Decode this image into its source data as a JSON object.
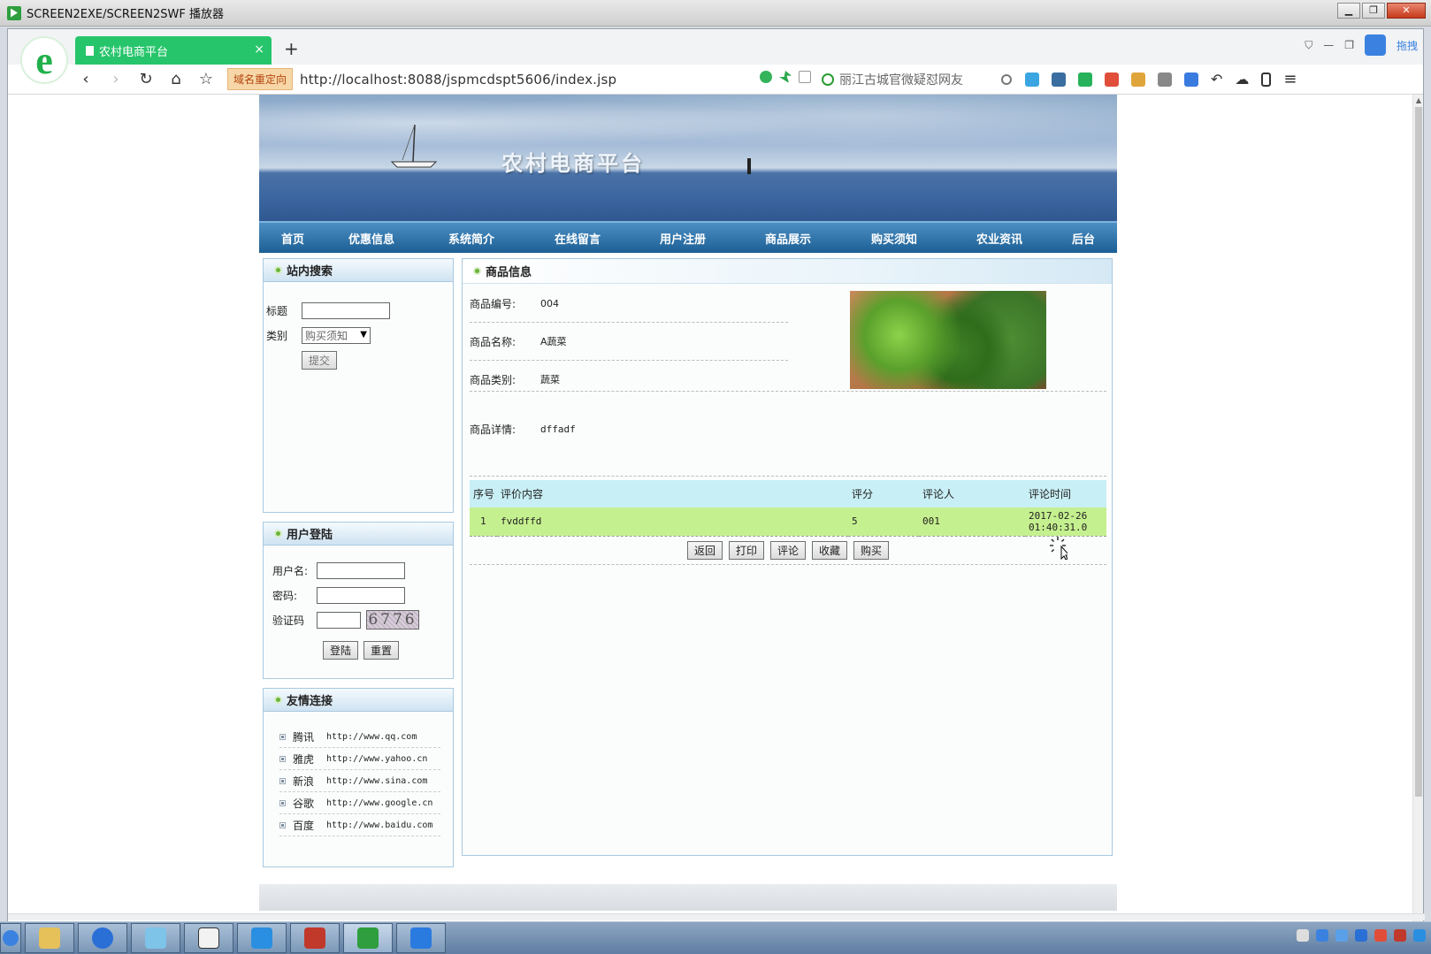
{
  "window": {
    "title": "SCREEN2EXE/SCREEN2SWF 播放器",
    "controls": [
      "minimize",
      "restore",
      "close"
    ]
  },
  "browser": {
    "tab_title": "农村电商平台",
    "tab_close": "×",
    "new_tab": "+",
    "redirect_tag": "域名重定向",
    "url": "http://localhost:8088/jspmcdspt5606/index.jsp",
    "search_text": "丽江古城官微疑怼网友",
    "side_tab": "拖拽"
  },
  "site": {
    "banner_title": "农村电商平台",
    "nav": [
      "首页",
      "优惠信息",
      "系统简介",
      "在线留言",
      "用户注册",
      "商品展示",
      "购买须知",
      "农业资讯",
      "后台"
    ]
  },
  "search_box": {
    "title": "站内搜索",
    "label_title": "标题",
    "label_category": "类别",
    "category_value": "购买须知",
    "submit": "提交"
  },
  "login_box": {
    "title": "用户登陆",
    "label_user": "用户名:",
    "label_password": "密码:",
    "label_captcha": "验证码",
    "captcha_text": "6776",
    "login": "登陆",
    "reset": "重置"
  },
  "links_box": {
    "title": "友情连接",
    "items": [
      {
        "name": "腾讯",
        "url": "http://www.qq.com"
      },
      {
        "name": "雅虎",
        "url": "http://www.yahoo.cn"
      },
      {
        "name": "新浪",
        "url": "http://www.sina.com"
      },
      {
        "name": "谷歌",
        "url": "http://www.google.cn"
      },
      {
        "name": "百度",
        "url": "http://www.baidu.com"
      }
    ]
  },
  "product": {
    "title": "商品信息",
    "code_label": "商品编号:",
    "code": "004",
    "name_label": "商品名称:",
    "name": "A蔬菜",
    "category_label": "商品类别:",
    "category": "蔬菜",
    "detail_label": "商品详情:",
    "detail": "dffadf"
  },
  "reviews": {
    "headers": [
      "序号",
      "评价内容",
      "评分",
      "评论人",
      "评论时间"
    ],
    "rows": [
      [
        "1",
        "fvddffd",
        "5",
        "001",
        "2017-02-26 01:40:31.0"
      ]
    ]
  },
  "actions": [
    "返回",
    "打印",
    "评论",
    "收藏",
    "购买"
  ],
  "colors": {
    "nav_bg": "#1c5f94",
    "tab_green": "#27c56b",
    "review_header": "#c8eff5",
    "review_row": "#c5f08f"
  }
}
